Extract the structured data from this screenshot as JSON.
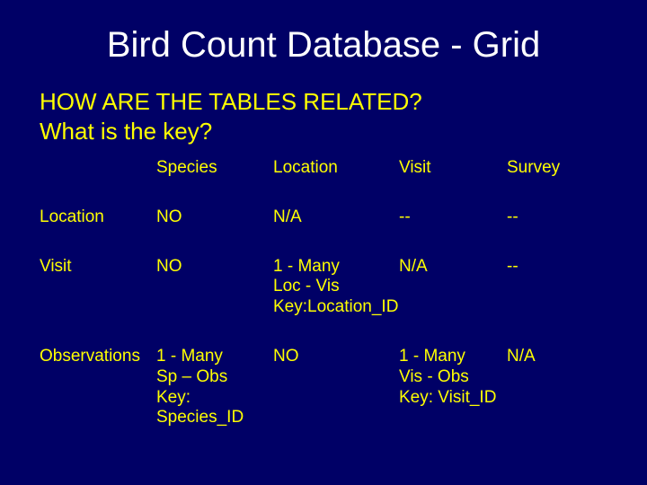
{
  "title": "Bird Count Database - Grid",
  "question_line1": "HOW ARE THE TABLES RELATED?",
  "question_line2": "What is the key?",
  "columns": {
    "c1": "Species",
    "c2": "Location",
    "c3": "Visit",
    "c4": "Survey"
  },
  "rows": {
    "location": {
      "label": "Location",
      "species": "NO",
      "location": "N/A",
      "visit": "--",
      "survey": "--"
    },
    "visit": {
      "label": "Visit",
      "species": "NO",
      "location": "1 - Many\nLoc - Vis\nKey:Location_ID",
      "visit": "N/A",
      "survey": "--"
    },
    "observations": {
      "label": "Observations",
      "species": "1 - Many\nSp – Obs\nKey: Species_ID",
      "location": "NO",
      "visit": "1 - Many\nVis - Obs\nKey: Visit_ID",
      "survey": "N/A"
    }
  }
}
